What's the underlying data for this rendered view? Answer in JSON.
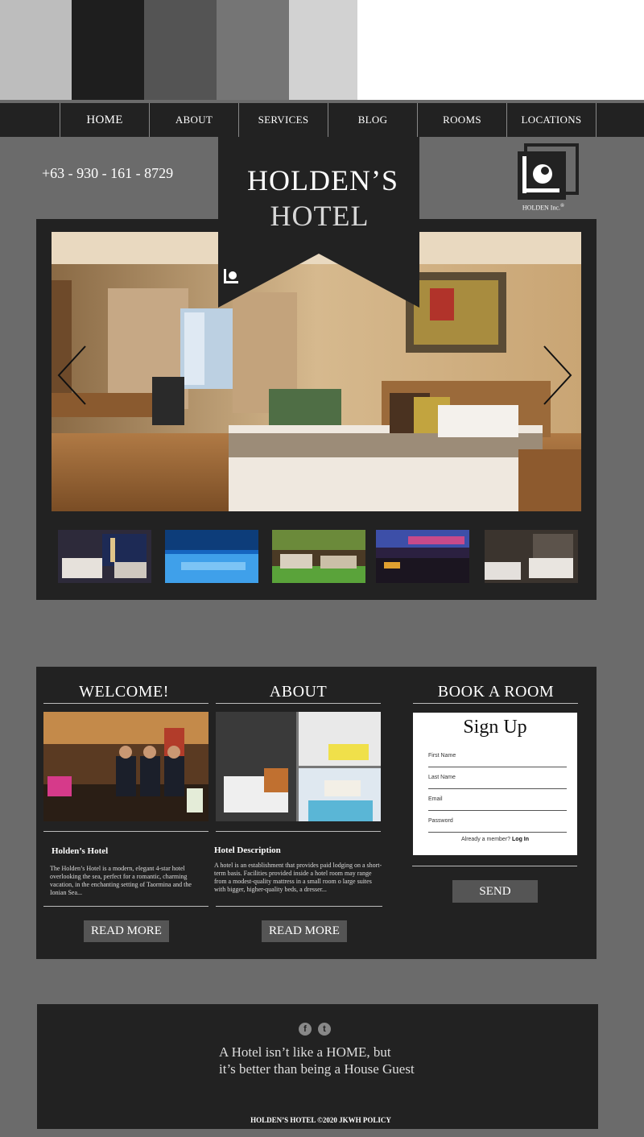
{
  "swatches": {
    "colors": [
      "#bdbdbd",
      "#1e1e1e",
      "#545454",
      "#757575",
      "#d2d2d2"
    ]
  },
  "nav": {
    "items": [
      "HOME",
      "ABOUT",
      "SERVICES",
      "BLOG",
      "ROOMS",
      "LOCATIONS"
    ]
  },
  "header": {
    "phone": "+63 - 930 - 161 - 8729",
    "title_line1": "HOLDEN’S",
    "title_line2": "HOTEL",
    "logo_text": "HOLDEN Inc.",
    "logo_mark": "®"
  },
  "slider": {
    "prev_icon": "chevron-left-icon",
    "next_icon": "chevron-right-icon",
    "thumbnails": [
      "night-city-room",
      "indoor-pool",
      "garden-lounge",
      "rooftop-bar-dusk",
      "twin-room"
    ]
  },
  "welcome": {
    "heading": "WELCOME!",
    "subheading": "Holden’s Hotel",
    "text": "The Holden’s Hotel is a modern, elegant 4-star hotel overlooking the sea, perfect for a romantic, charming vacation, in the enchanting setting of Taormina and the Ionian Sea...",
    "button": "READ MORE"
  },
  "about": {
    "heading": "ABOUT",
    "subheading": "Hotel Description",
    "text": "A hotel is an establishment that provides paid lodging on a short-term basis. Facilities provided inside a hotel room may range from a modest-quality mattress in a small room o large suites with bigger, higher-quality beds, a dresser...",
    "button": "READ MORE"
  },
  "booking": {
    "heading": "BOOK A ROOM",
    "form_title": "Sign Up",
    "fields": [
      "First Name",
      "Last Name",
      "Email",
      "Password"
    ],
    "member_text": "Already a member?",
    "login_link": "Log In",
    "button": "SEND"
  },
  "footer": {
    "social": [
      "f",
      "t"
    ],
    "quote_line1": "A Hotel isn’t like a HOME, but",
    "quote_line2": "it’s better than being a House Guest",
    "copyright": "HOLDEN’S HOTEL ©2020 JKWH POLICY"
  },
  "colors": {
    "dark": "#222222",
    "page_bg": "#6b6b6b",
    "button": "#555555"
  }
}
